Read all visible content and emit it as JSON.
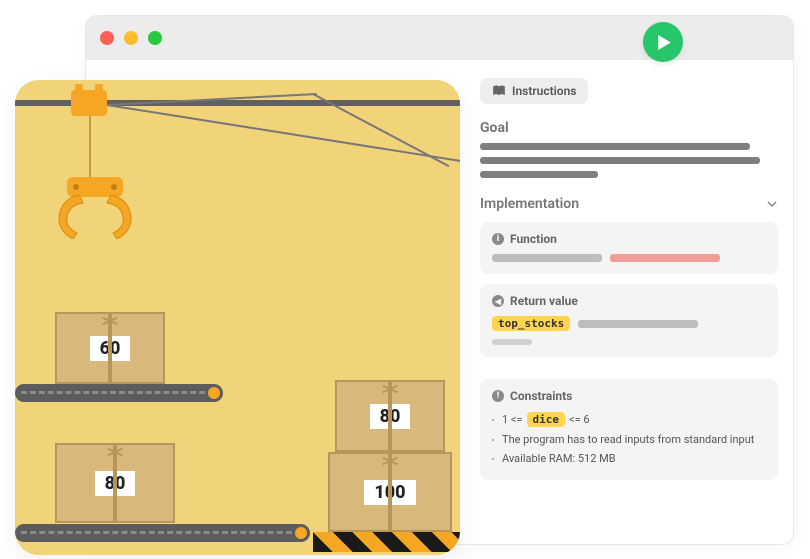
{
  "tab": {
    "label": "Instructions"
  },
  "goal": {
    "heading": "Goal"
  },
  "impl": {
    "heading": "Implementation",
    "function": {
      "title": "Function"
    },
    "return": {
      "title": "Return value",
      "chip": "top_stocks"
    },
    "constraints": {
      "title": "Constraints",
      "c1_pre": "1 <=",
      "c1_chip": "dice",
      "c1_post": "<= 6",
      "c2": "The program has to read inputs from standard input",
      "c3": "Available RAM: 512 MB"
    }
  },
  "boxes": {
    "b1": "60",
    "b2": "80",
    "b3": "80",
    "b4": "100"
  }
}
